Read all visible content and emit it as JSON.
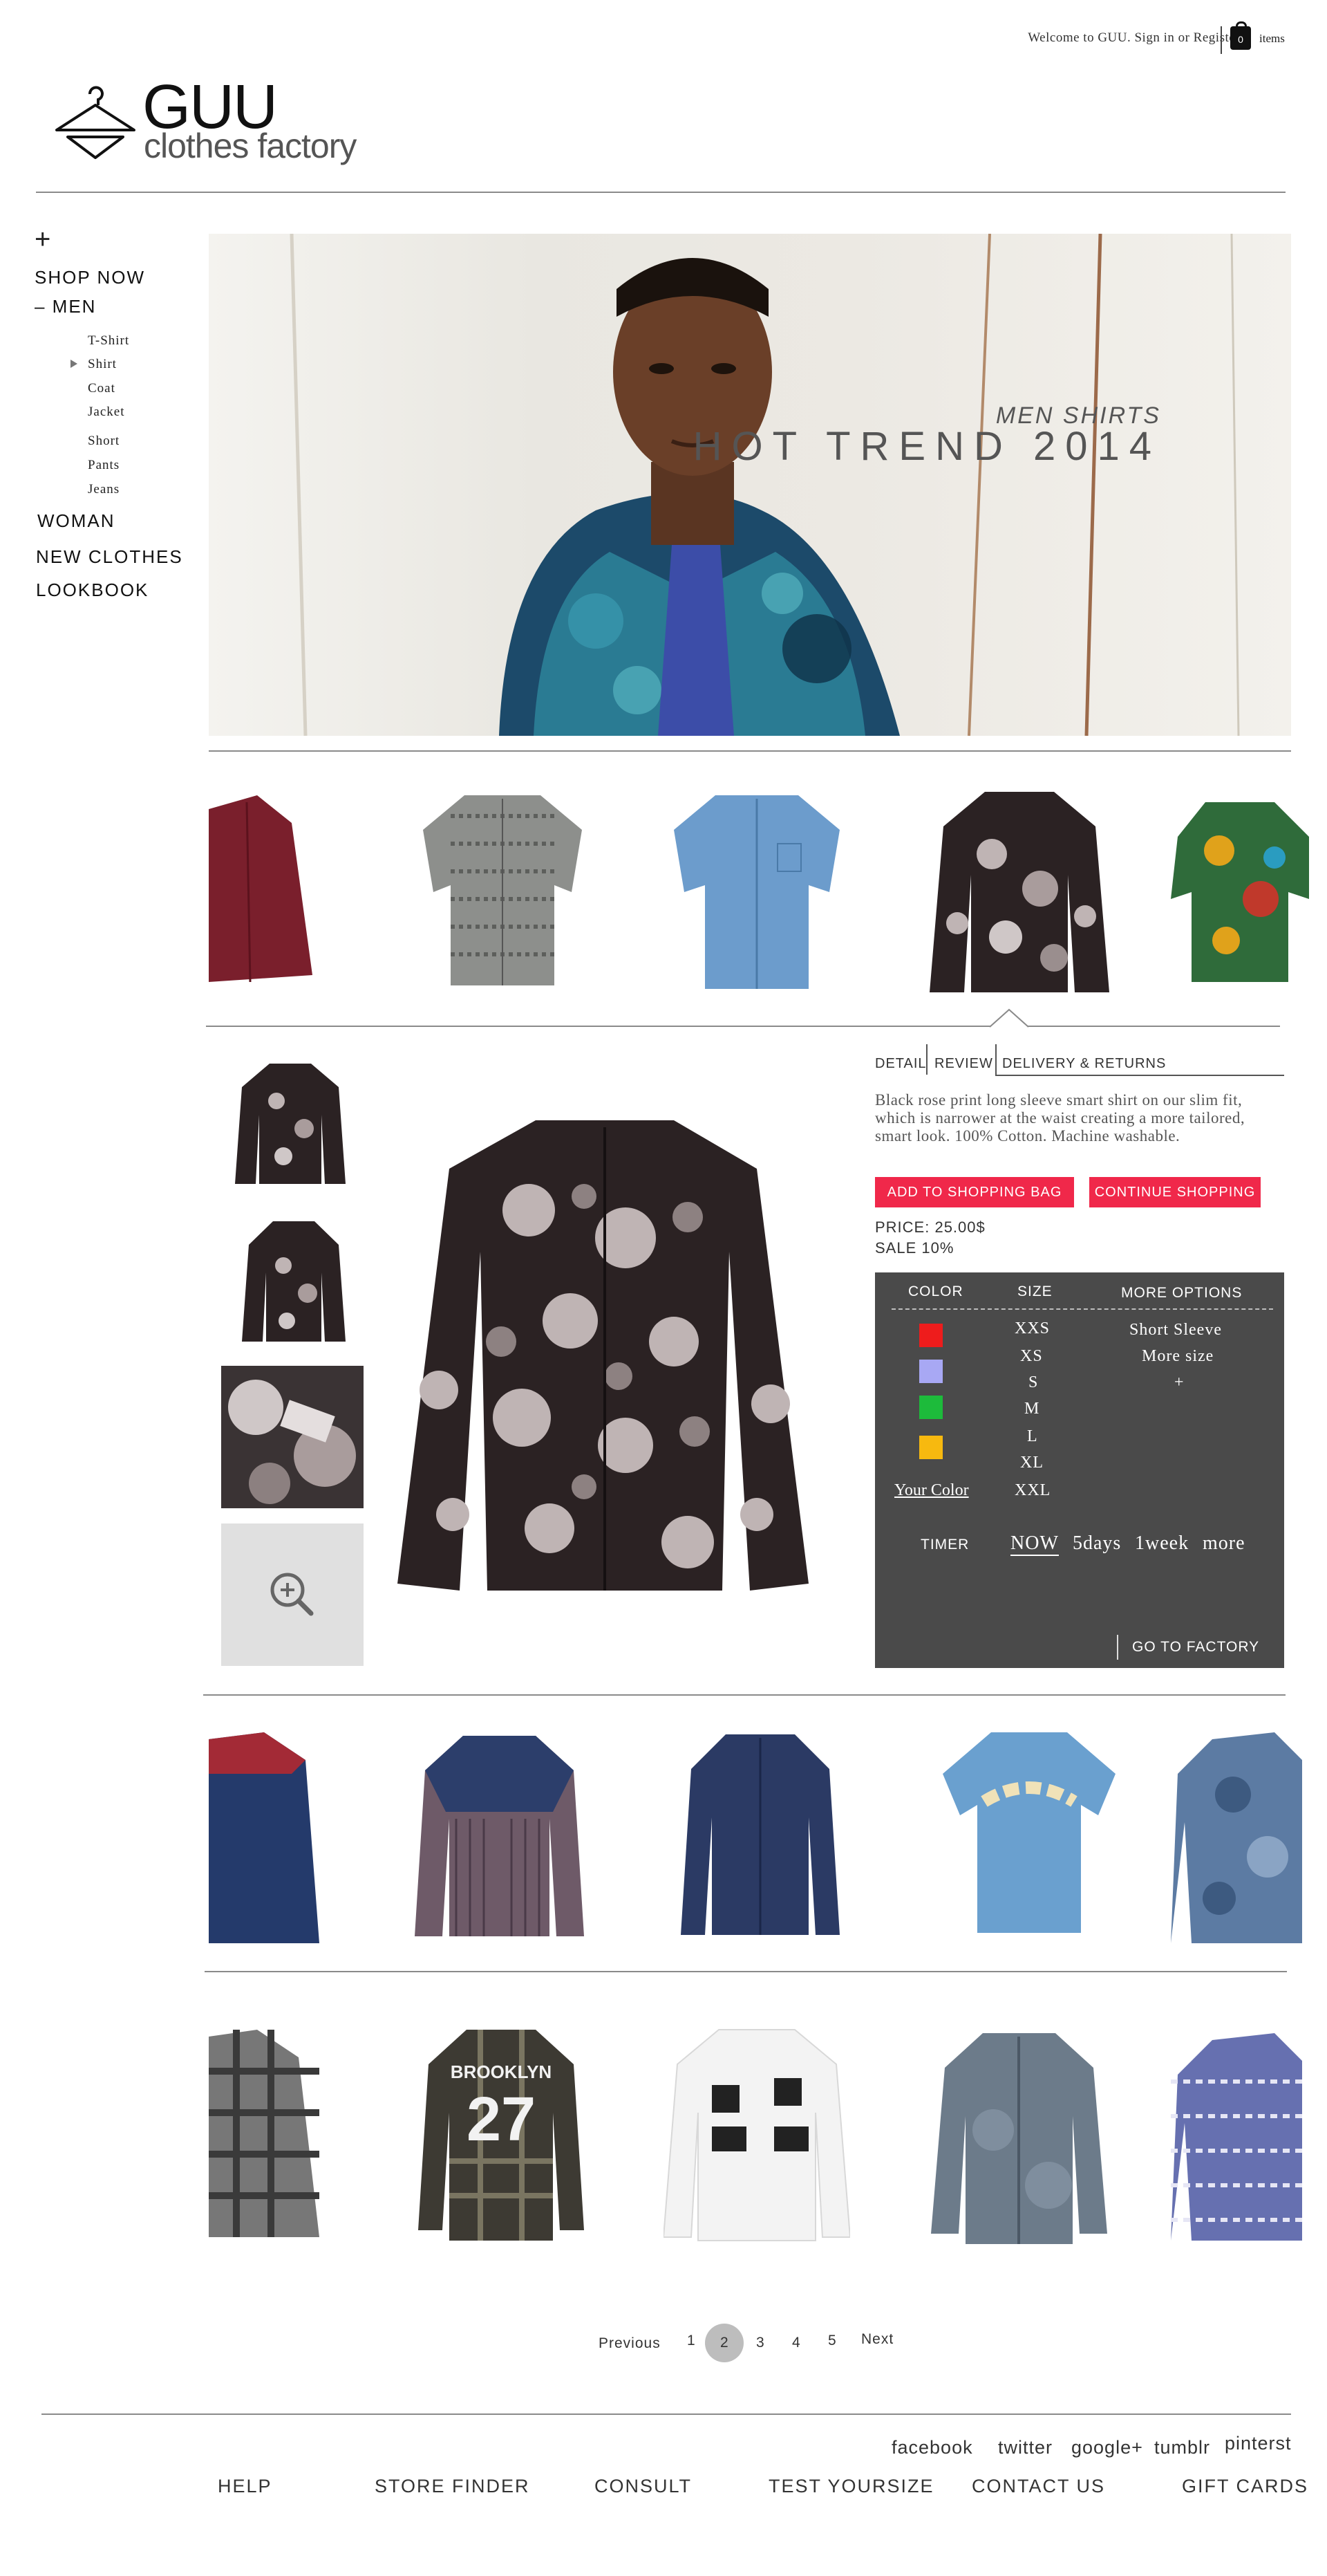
{
  "header": {
    "welcome": "Welcome to GUU. Sign in or Register",
    "cart_count": "0",
    "cart_label": "items",
    "logo_name": "GUU",
    "logo_sub": "clothes factory"
  },
  "sidebar": {
    "plus": "+",
    "shop_now": "SHOP NOW",
    "men": "– MEN",
    "men_items": [
      "T-Shirt",
      "Shirt",
      "Coat",
      "Jacket",
      "Short",
      "Pants",
      "Jeans"
    ],
    "woman": "WOMAN",
    "new_clothes": "NEW CLOTHES",
    "lookbook": "LOOKBOOK"
  },
  "hero": {
    "subtitle": "MEN SHIRTS",
    "title": "HOT TREND 2014"
  },
  "tabs": [
    "DETAIL",
    "REVIEW",
    "DELIVERY & RETURNS"
  ],
  "product": {
    "description": "Black rose print long sleeve smart shirt on our slim fit, which is narrower at the waist creating a more tailored, smart look. 100% Cotton. Machine washable.",
    "add_to_bag": "ADD TO SHOPPING BAG",
    "continue": "CONTINUE SHOPPING",
    "price": "PRICE: 25.00$",
    "sale": "SALE 10%"
  },
  "options_panel": {
    "color_header": "COLOR",
    "size_header": "SIZE",
    "more_header": "MORE OPTIONS",
    "colors": [
      "#ee1c1c",
      "#a8a8f4",
      "#1dbb3b",
      "#f7b90f"
    ],
    "your_color": "Your Color",
    "sizes": [
      "XXS",
      "XS",
      "S",
      "M",
      "L",
      "XL",
      "XXL"
    ],
    "more": [
      "Short Sleeve",
      "More size",
      "+"
    ],
    "timer_label": "TIMER",
    "timer_options": [
      "NOW",
      "5days",
      "1week",
      "more"
    ],
    "go_factory": "GO TO FACTORY"
  },
  "pagination": {
    "previous": "Previous",
    "pages": [
      "1",
      "2",
      "3",
      "4",
      "5"
    ],
    "current": "2",
    "next": "Next"
  },
  "footer": {
    "social": [
      "facebook",
      "twitter",
      "google+",
      "tumblr",
      "pinterst"
    ],
    "nav": [
      "HELP",
      "STORE FINDER",
      "CONSULT",
      "TEST YOURSIZE",
      "CONTACT US",
      "GIFT CARDS"
    ]
  },
  "shirt_prints": {
    "brooklyn": "BROOKLYN",
    "number": "27"
  }
}
